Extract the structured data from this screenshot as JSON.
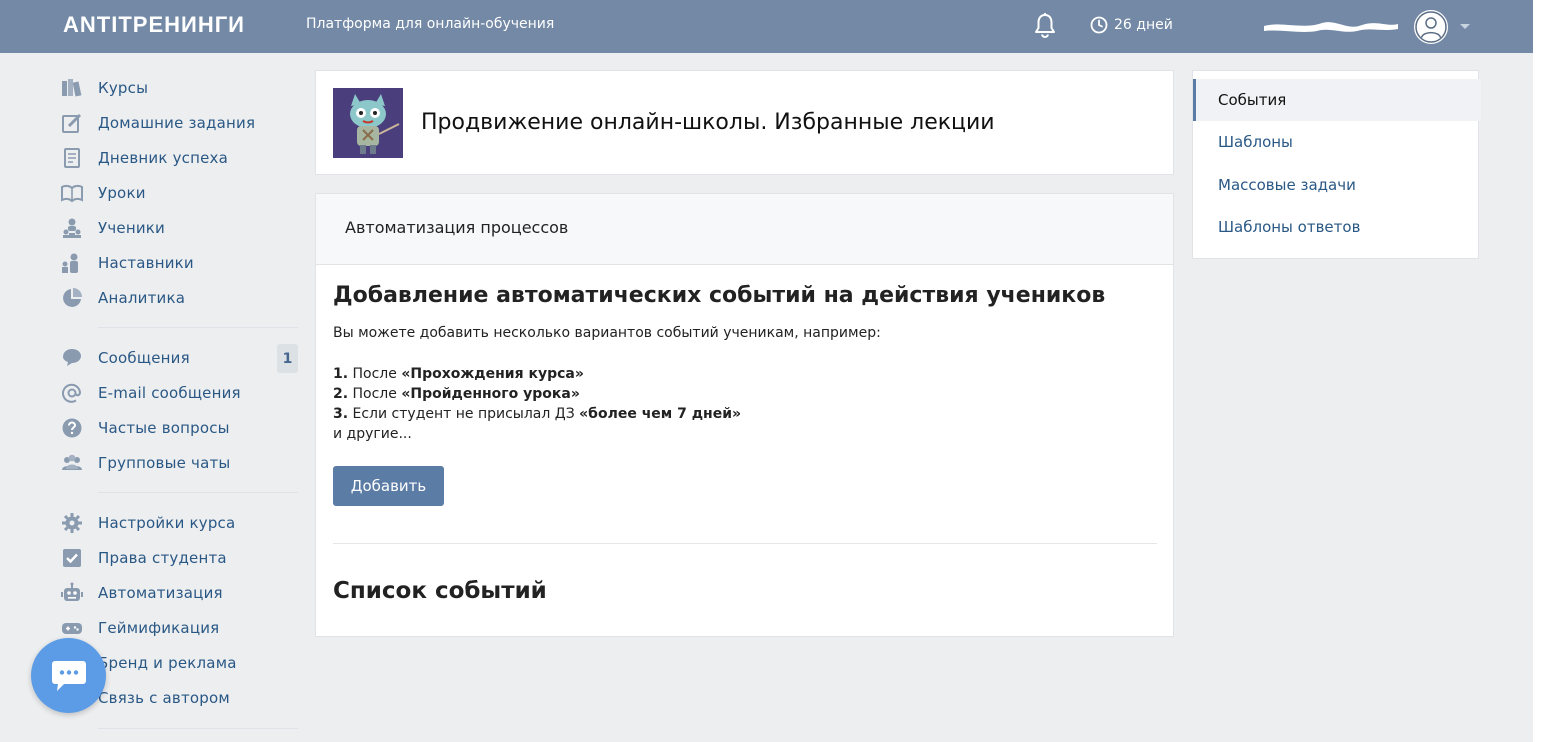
{
  "header": {
    "logo": "ANTITРЕНИНГИ",
    "tagline": "Платформа для онлайн-обучения",
    "days": "26 дней"
  },
  "sidebar": {
    "group1": [
      {
        "label": "Курсы",
        "icon": "courses-icon"
      },
      {
        "label": "Домашние задания",
        "icon": "homework-icon"
      },
      {
        "label": "Дневник успеха",
        "icon": "diary-icon"
      },
      {
        "label": "Уроки",
        "icon": "lessons-icon"
      },
      {
        "label": "Ученики",
        "icon": "students-icon"
      },
      {
        "label": "Наставники",
        "icon": "mentors-icon"
      },
      {
        "label": "Аналитика",
        "icon": "analytics-icon"
      }
    ],
    "group2": [
      {
        "label": "Сообщения",
        "icon": "messages-icon",
        "badge": "1"
      },
      {
        "label": "E-mail сообщения",
        "icon": "at-icon"
      },
      {
        "label": "Частые вопросы",
        "icon": "question-icon"
      },
      {
        "label": "Групповые чаты",
        "icon": "group-chat-icon"
      }
    ],
    "group3": [
      {
        "label": "Настройки курса",
        "icon": "gear-icon"
      },
      {
        "label": "Права студента",
        "icon": "checkbox-icon"
      },
      {
        "label": "Автоматизация",
        "icon": "robot-icon"
      },
      {
        "label": "Геймификация",
        "icon": "gamepad-icon"
      },
      {
        "label": "Бренд и реклама",
        "icon": "brand-icon"
      },
      {
        "label": "Связь с автором",
        "icon": "contact-icon"
      }
    ]
  },
  "course": {
    "title": "Продвижение онлайн-школы. Избранные лекции"
  },
  "main": {
    "section_title": "Автоматизация процессов",
    "heading": "Добавление автоматических событий на действия учеников",
    "description": "Вы можете добавить несколько вариантов событий ученикам, например:",
    "steps": [
      {
        "num": "1.",
        "text": "После ",
        "strong": "«Прохождения курса»"
      },
      {
        "num": "2.",
        "text": "После ",
        "strong": "«Пройденного урока»"
      },
      {
        "num": "3.",
        "text": "Если студент не присылал ДЗ ",
        "strong": "«более чем 7 дней»"
      }
    ],
    "steps_tail": "и другие...",
    "add_button": "Добавить",
    "list_heading": "Список событий"
  },
  "right_nav": {
    "items": [
      "События",
      "Шаблоны",
      "Массовые задачи",
      "Шаблоны ответов"
    ],
    "active_index": 0
  },
  "colors": {
    "topbar": "#7389a6",
    "link": "#2a5885",
    "button": "#5b7ca5",
    "chat_fab": "#5c9ce6"
  }
}
